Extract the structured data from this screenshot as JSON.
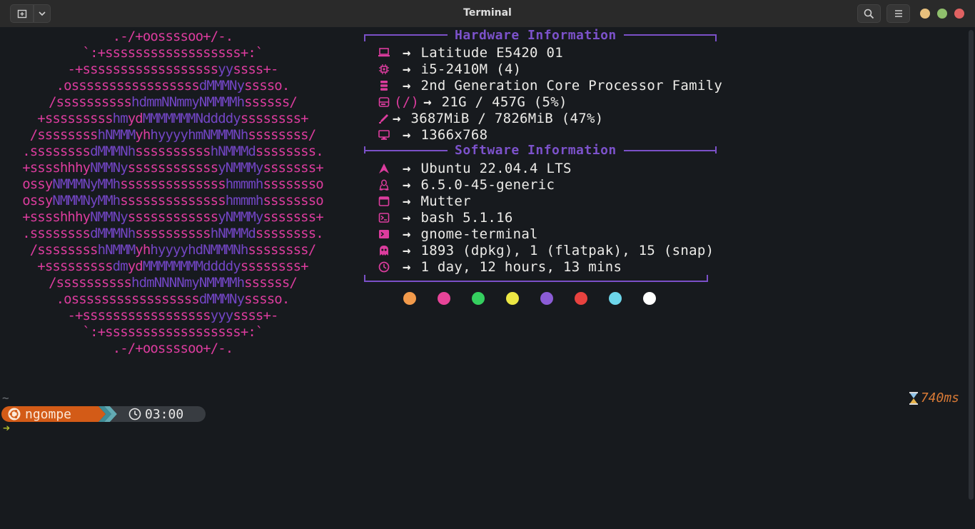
{
  "window": {
    "title": "Terminal",
    "traffic_colors": {
      "minimize": "#e8c07d",
      "maximize": "#8fbf6c",
      "close": "#e06262"
    }
  },
  "logo": {
    "lines": [
      [
        [
          "p",
          ".-/+oossssoo+/-."
        ]
      ],
      [
        [
          "p",
          "`:+ssssssssssssssssss+:`"
        ]
      ],
      [
        [
          "p",
          "-+ssssssssssssssssss"
        ],
        [
          "b",
          "yy"
        ],
        [
          "p",
          "ssss+-"
        ]
      ],
      [
        [
          "p",
          ".osssssssssssssssss"
        ],
        [
          "b",
          "dMMMNy"
        ],
        [
          "p",
          "sssso."
        ]
      ],
      [
        [
          "p",
          "/ssssssssss"
        ],
        [
          "b",
          "hdmmNNmmyNMMMMh"
        ],
        [
          "p",
          "ssssss/"
        ]
      ],
      [
        [
          "p",
          "+sssssssss"
        ],
        [
          "b",
          "hm"
        ],
        [
          "p",
          "yd"
        ],
        [
          "b",
          "MMMMMMMNddddy"
        ],
        [
          "p",
          "ssssssss+"
        ]
      ],
      [
        [
          "p",
          "/ssssssss"
        ],
        [
          "b",
          "hNMMM"
        ],
        [
          "p",
          "yh"
        ],
        [
          "b",
          "hyyyyhmNMMMNh"
        ],
        [
          "p",
          "ssssssss/"
        ]
      ],
      [
        [
          "p",
          ".ssssssss"
        ],
        [
          "b",
          "dMMMNh"
        ],
        [
          "p",
          "ssssssssss"
        ],
        [
          "b",
          "hNMMMd"
        ],
        [
          "p",
          "ssssssss."
        ]
      ],
      [
        [
          "p",
          "+sssshhhy"
        ],
        [
          "b",
          "NMMNy"
        ],
        [
          "p",
          "ssssssssssss"
        ],
        [
          "b",
          "yNMMMy"
        ],
        [
          "p",
          "sssssss+"
        ]
      ],
      [
        [
          "p",
          "ossy"
        ],
        [
          "b",
          "NMMMNyMMh"
        ],
        [
          "p",
          "ssssssssssssss"
        ],
        [
          "b",
          "hmmmh"
        ],
        [
          "p",
          "ssssssso"
        ]
      ],
      [
        [
          "p",
          "ossy"
        ],
        [
          "b",
          "NMMMNyMMh"
        ],
        [
          "p",
          "ssssssssssssss"
        ],
        [
          "b",
          "hmmmh"
        ],
        [
          "p",
          "ssssssso"
        ]
      ],
      [
        [
          "p",
          "+sssshhhy"
        ],
        [
          "b",
          "NMMNy"
        ],
        [
          "p",
          "ssssssssssss"
        ],
        [
          "b",
          "yNMMMy"
        ],
        [
          "p",
          "sssssss+"
        ]
      ],
      [
        [
          "p",
          ".ssssssss"
        ],
        [
          "b",
          "dMMMNh"
        ],
        [
          "p",
          "ssssssssss"
        ],
        [
          "b",
          "hNMMMd"
        ],
        [
          "p",
          "ssssssss."
        ]
      ],
      [
        [
          "p",
          "/ssssssss"
        ],
        [
          "b",
          "hNMMM"
        ],
        [
          "p",
          "yh"
        ],
        [
          "b",
          "hyyyyhdNMMMNh"
        ],
        [
          "p",
          "ssssssss/"
        ]
      ],
      [
        [
          "p",
          "+sssssssss"
        ],
        [
          "b",
          "dm"
        ],
        [
          "p",
          "yd"
        ],
        [
          "b",
          "MMMMMMMMddddy"
        ],
        [
          "p",
          "ssssssss+"
        ]
      ],
      [
        [
          "p",
          "/ssssssssss"
        ],
        [
          "b",
          "hdmNNNNmyNMMMMh"
        ],
        [
          "p",
          "ssssss/"
        ]
      ],
      [
        [
          "p",
          ".osssssssssssssssss"
        ],
        [
          "b",
          "dMMMNy"
        ],
        [
          "p",
          "sssso."
        ]
      ],
      [
        [
          "p",
          "-+sssssssssssssssss"
        ],
        [
          "b",
          "yyy"
        ],
        [
          "p",
          "ssss+-"
        ]
      ],
      [
        [
          "p",
          "`:+ssssssssssssssssss+:`"
        ]
      ],
      [
        [
          "p",
          ".-/+oossssoo+/-."
        ]
      ]
    ]
  },
  "hardware": {
    "title": "Hardware Information",
    "rows": [
      {
        "icon": "laptop-icon",
        "label": "",
        "value": "Latitude E5420 01"
      },
      {
        "icon": "cpu-icon",
        "label": "",
        "value": "i5-2410M (4)"
      },
      {
        "icon": "chip-icon",
        "label": "",
        "value": "2nd Generation Core Processor Family"
      },
      {
        "icon": "disk-icon",
        "label": "(/)",
        "value": "21G / 457G (5%)"
      },
      {
        "icon": "memory-icon",
        "label": "",
        "value": "3687MiB / 7826MiB (47%)"
      },
      {
        "icon": "monitor-icon",
        "label": "",
        "value": "1366x768"
      }
    ]
  },
  "software": {
    "title": "Software Information",
    "rows": [
      {
        "icon": "distro-icon",
        "value": "Ubuntu 22.04.4 LTS"
      },
      {
        "icon": "linux-icon",
        "value": "6.5.0-45-generic"
      },
      {
        "icon": "window-icon",
        "value": "Mutter"
      },
      {
        "icon": "shell-icon",
        "value": "bash 5.1.16"
      },
      {
        "icon": "terminal-icon",
        "value": "gnome-terminal"
      },
      {
        "icon": "packages-icon",
        "value": "1893 (dpkg), 1 (flatpak), 15 (snap)"
      },
      {
        "icon": "clock-icon",
        "value": "1 day, 12 hours, 13 mins"
      }
    ]
  },
  "arrow": "→",
  "palette": [
    "#f29a4b",
    "#e74498",
    "#35cf5f",
    "#ece744",
    "#8b5cd6",
    "#e8423f",
    "#6dd6ea",
    "#ffffff"
  ],
  "prompt": {
    "cwd": "~",
    "user": "ngompe",
    "time": "03:00",
    "duration": "740ms",
    "cursor": "➔"
  }
}
